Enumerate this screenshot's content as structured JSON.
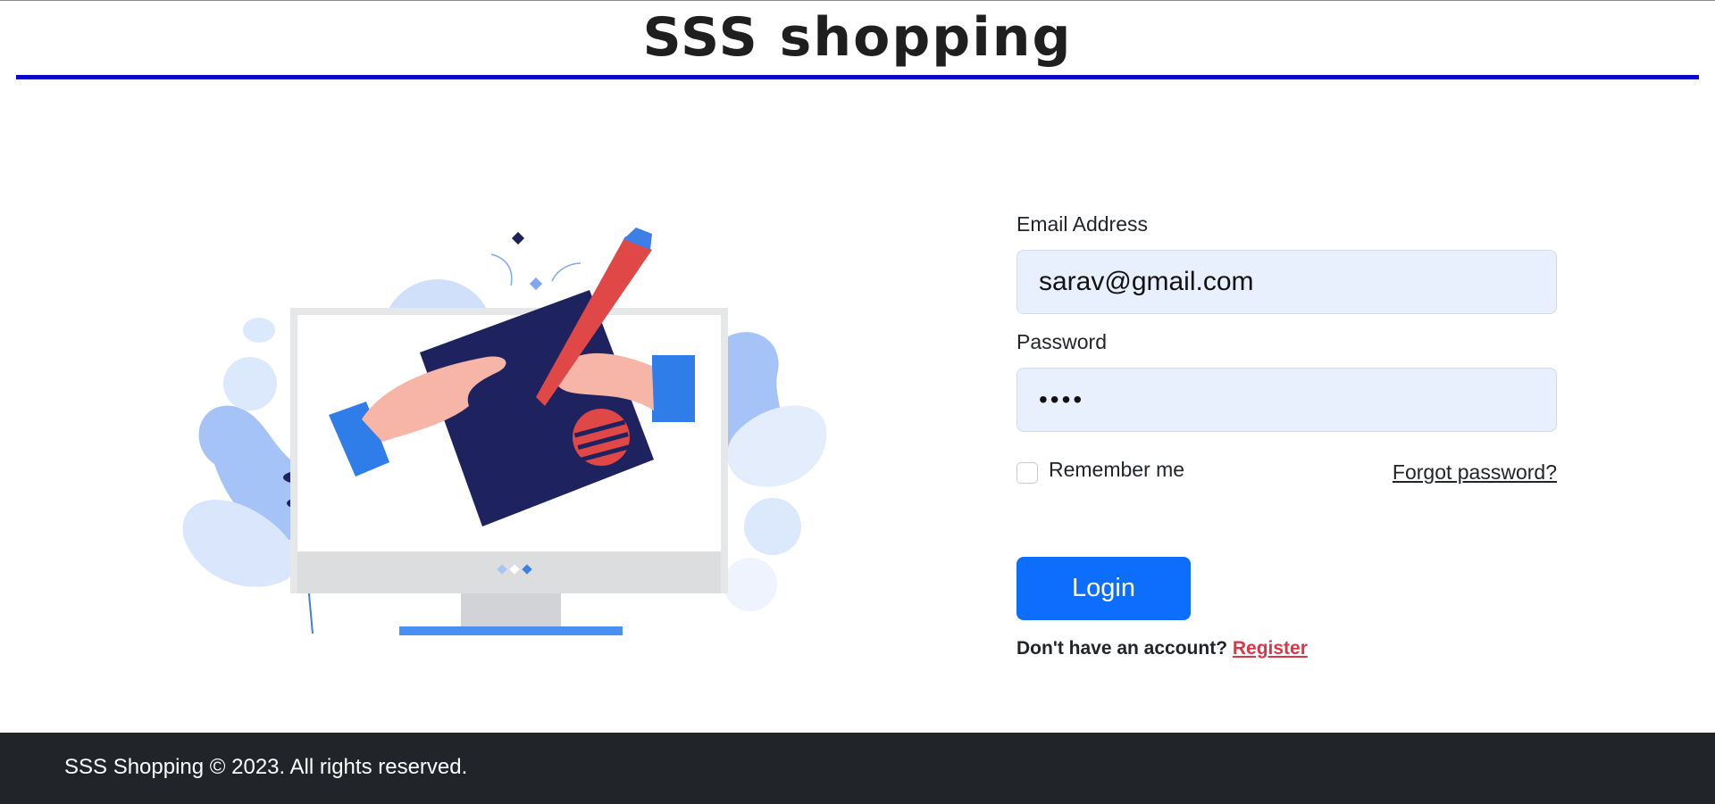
{
  "header": {
    "title": "SSS shopping"
  },
  "illustration": {
    "icon": "login-illustration"
  },
  "login_form": {
    "email_label": "Email Address",
    "email_value": "sarav@gmail.com",
    "password_label": "Password",
    "password_value": "••••",
    "remember_label": "Remember me",
    "remember_checked": false,
    "forgot_link": "Forgot password?",
    "login_button": "Login",
    "register_prompt": "Don't have an account?",
    "register_link": "Register"
  },
  "footer": {
    "text": "SSS Shopping © 2023. All rights reserved."
  },
  "colors": {
    "header_rule": "#0a07c9",
    "primary_button": "#0d6efd",
    "input_background": "#e8f0fe",
    "register_link": "#dc3545",
    "footer_background": "#212529"
  }
}
